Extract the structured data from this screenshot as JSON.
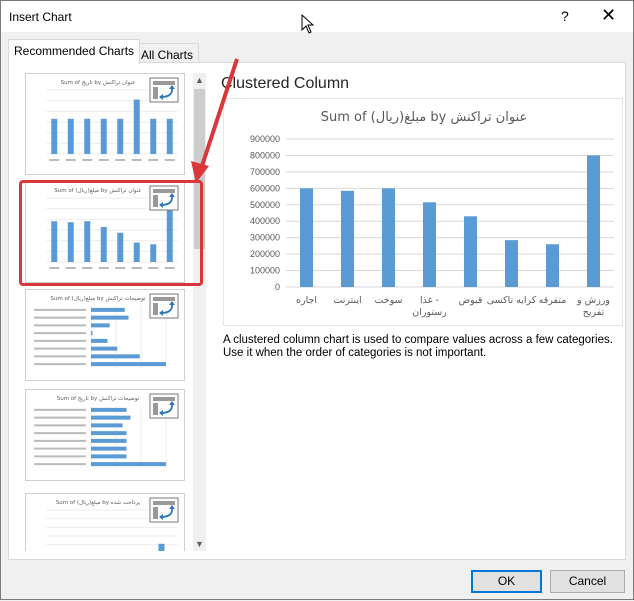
{
  "window": {
    "title": "Insert Chart",
    "help": "?",
    "close": "✕"
  },
  "tabs": [
    {
      "label": "Recommended Charts",
      "active": true
    },
    {
      "label": "All Charts",
      "active": false
    }
  ],
  "thumbnails": [
    {
      "title": "Sum of تاریخ by عنوان تراکنش",
      "type": "column",
      "values": [
        0.55,
        0.55,
        0.55,
        0.55,
        0.55,
        0.85,
        0.55,
        0.55
      ]
    },
    {
      "title": "Sum of (ریال)مبلغ by عنوان تراکنش",
      "type": "column",
      "values": [
        600000,
        585000,
        600000,
        515000,
        430000,
        285000,
        260000,
        800000
      ],
      "selected": true
    },
    {
      "title": "Sum of (ریال)مبلغ by توضیحات تراکنش",
      "type": "bar",
      "values": [
        0.45,
        0.5,
        0.25,
        0.02,
        0.22,
        0.35,
        0.65,
        1.0
      ]
    },
    {
      "title": "Sum of تاریخ by توضیحات تراکنش",
      "type": "bar",
      "values": [
        0.45,
        0.5,
        0.4,
        0.45,
        0.45,
        0.45,
        0.45,
        0.95
      ]
    },
    {
      "title": "Sum of (ریال)مبلغ by پرداخت شده",
      "type": "column",
      "values": [
        0.15,
        0.4
      ]
    }
  ],
  "preview": {
    "chart_type_label": "Clustered Column",
    "description": "A clustered column chart is used to compare values across a few categories. Use it when the order of categories is not important."
  },
  "chart_data": {
    "type": "bar",
    "title": "Sum of (ریال)مبلغ by عنوان تراکنش",
    "categories": [
      "اجاره",
      "اینترنت",
      "سوخت",
      "غذا - رستوران",
      "قبوض",
      "کرایه تاکسی",
      "متفرقه",
      "ورزش و تفریح"
    ],
    "values": [
      600000,
      585000,
      600000,
      515000,
      430000,
      285000,
      260000,
      800000
    ],
    "ylim": [
      0,
      900000
    ],
    "yticks": [
      "0",
      "100000",
      "200000",
      "300000",
      "400000",
      "500000",
      "600000",
      "700000",
      "800000",
      "900000"
    ],
    "grid": true,
    "bar_color": "#5b9bd5"
  },
  "buttons": {
    "ok": "OK",
    "cancel": "Cancel"
  },
  "colors": {
    "highlight": "#d9373a",
    "accent": "#0078d7"
  }
}
